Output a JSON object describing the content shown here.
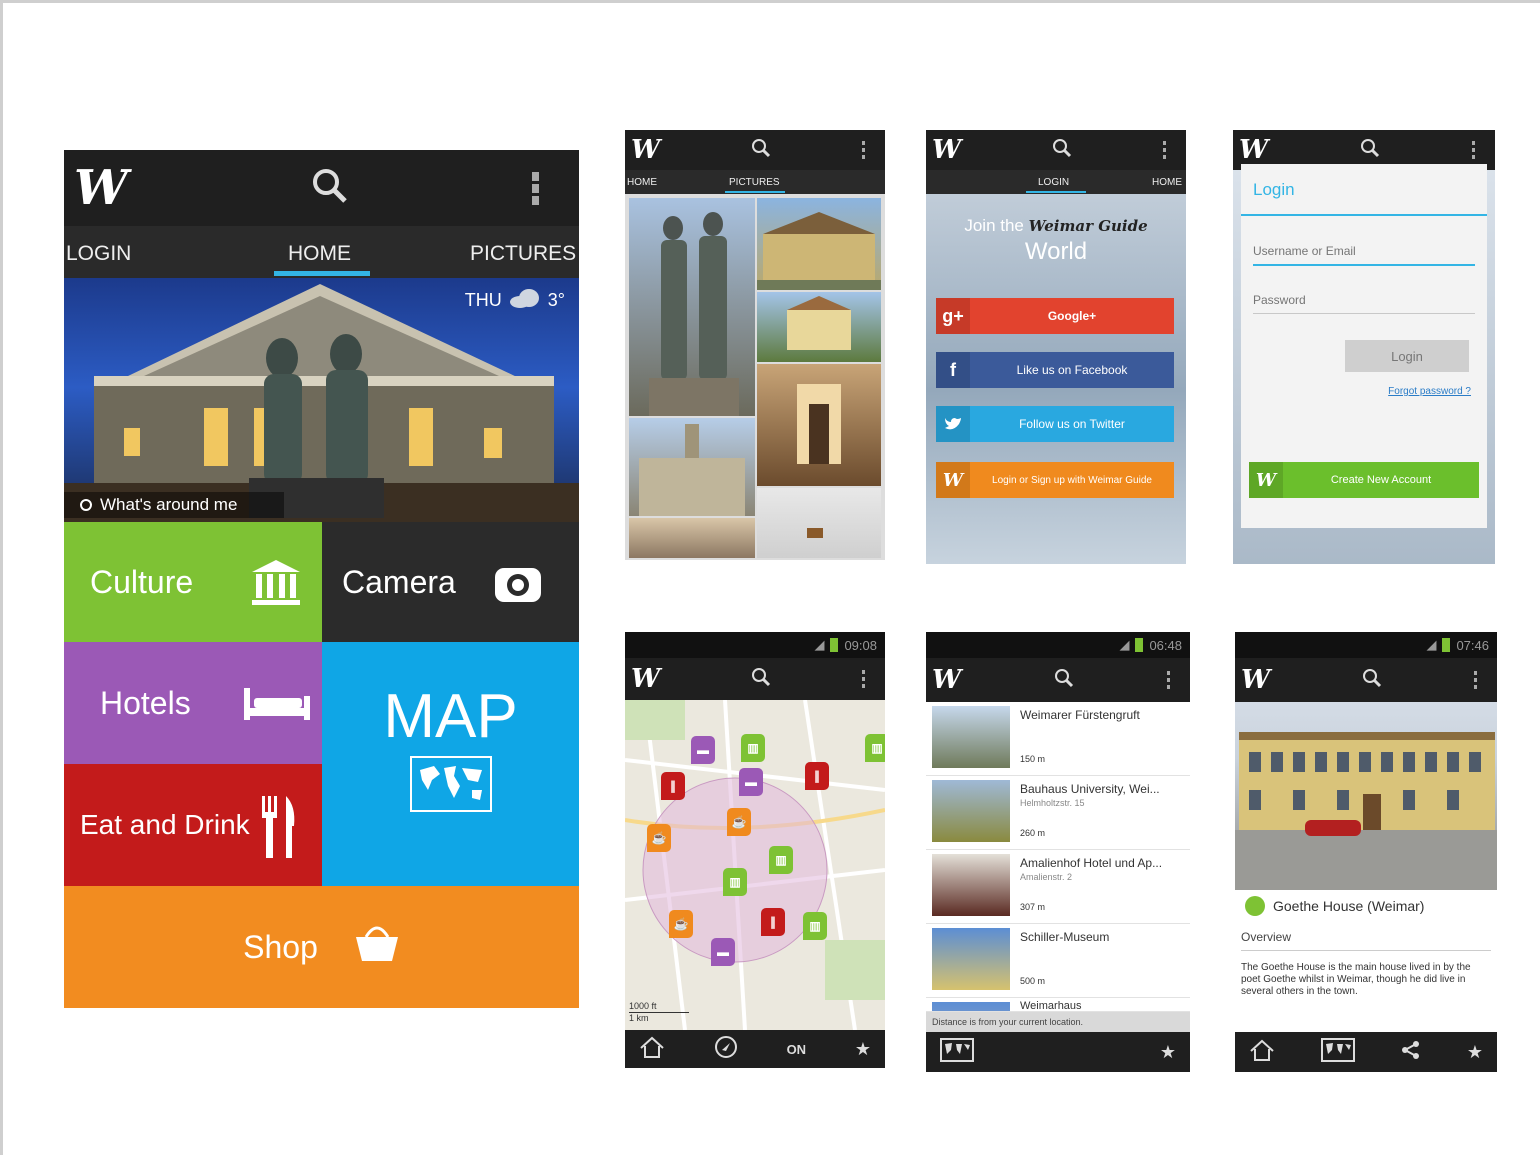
{
  "colors": {
    "culture": "#7ec234",
    "camera": "#2b2b2b",
    "hotels": "#9b59b6",
    "eat": "#c31b1b",
    "map": "#0fa6e6",
    "shop": "#f28c20",
    "tab_indicator": "#33b5e5",
    "google": "#e2432e",
    "facebook": "#3b5a9a",
    "twitter": "#29a8e0",
    "weimar": "#f08a1e",
    "create_account": "#6bbf2c"
  },
  "app": {
    "logo": "W"
  },
  "home": {
    "tabs": [
      "LOGIN",
      "HOME",
      "PICTURES"
    ],
    "weather": {
      "day": "THU",
      "temp": "3°",
      "icon": "cloud-icon"
    },
    "around_me": "What's around me",
    "tiles": {
      "culture": "Culture",
      "camera": "Camera",
      "hotels": "Hotels",
      "map": "MAP",
      "eat": "Eat and Drink",
      "shop": "Shop"
    }
  },
  "pictures_screen": {
    "tabs": [
      "HOME",
      "PICTURES"
    ]
  },
  "join_screen": {
    "tabs": [
      "LOGIN",
      "HOME"
    ],
    "heading_prefix": "Join the",
    "brand": "Weimar Guide",
    "heading_suffix": "World",
    "buttons": {
      "google": {
        "icon": "g+",
        "label": "Google+"
      },
      "facebook": {
        "icon": "f",
        "label": "Like us on Facebook"
      },
      "twitter": {
        "icon": "t",
        "label": "Follow us on Twitter"
      },
      "weimar": {
        "icon": "W",
        "label": "Login or Sign up with Weimar Guide"
      }
    }
  },
  "login_screen": {
    "title": "Login",
    "username_placeholder": "Username or Email",
    "password_placeholder": "Password",
    "login_button": "Login",
    "forgot": "Forgot password ?",
    "create_account": "Create New Account"
  },
  "map_screen": {
    "time": "09:08",
    "scale_top": "1000 ft",
    "scale_bottom": "1 km",
    "toggle": "ON"
  },
  "list_screen": {
    "time": "06:48",
    "items": [
      {
        "name": "Weimarer Fürstengruft",
        "address": "",
        "distance": "150 m"
      },
      {
        "name": "Bauhaus University, Wei...",
        "address": "Helmholtzstr. 15",
        "distance": "260 m"
      },
      {
        "name": "Amalienhof Hotel und Ap...",
        "address": "Amalienstr. 2",
        "distance": "307 m"
      },
      {
        "name": "Schiller-Museum",
        "address": "",
        "distance": "500 m"
      },
      {
        "name": "Weimarhaus",
        "address": "",
        "distance": ""
      }
    ],
    "footer": "Distance is from your current location."
  },
  "detail_screen": {
    "time": "07:46",
    "title": "Goethe House (Weimar)",
    "section": "Overview",
    "text": "The Goethe House is the main house lived in by the poet Goethe whilst in Weimar, though he did live in several others in the town."
  }
}
